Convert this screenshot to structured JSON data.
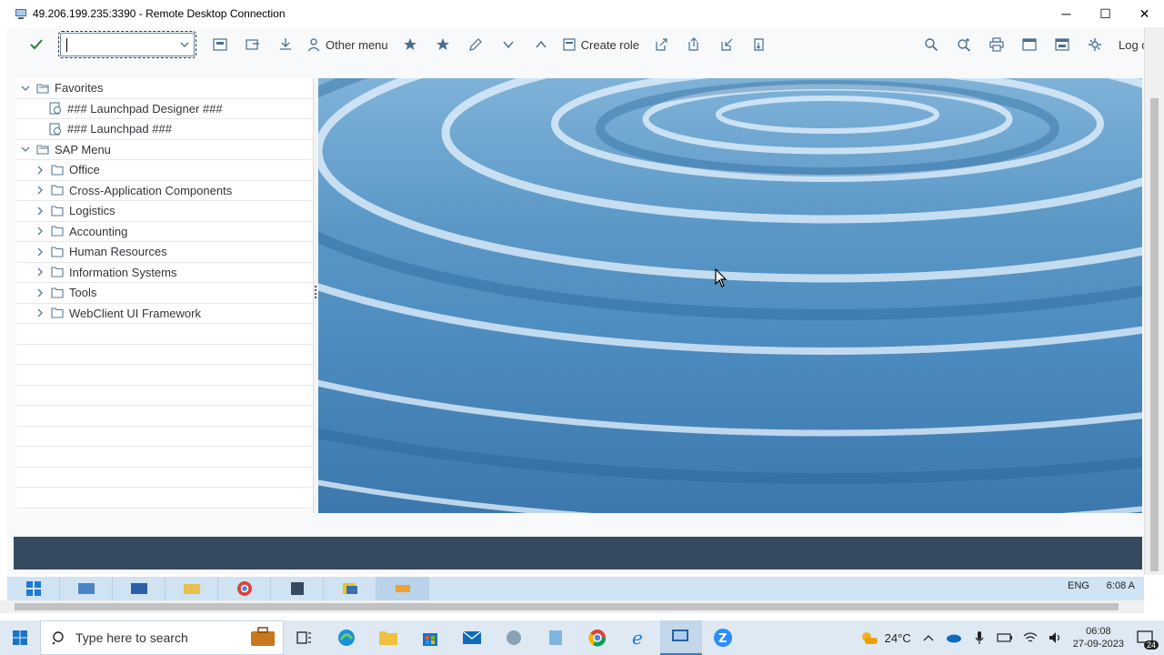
{
  "rdp": {
    "title": "49.206.199.235:3390 - Remote Desktop Connection",
    "controls": {
      "minimize": "─",
      "maximize": "☐",
      "close": "✕"
    }
  },
  "toolbar": {
    "transaction_value": "",
    "other_menu_label": "Other menu",
    "create_role_label": "Create role",
    "logoff_label": "Log off"
  },
  "tree": {
    "favorites": {
      "label": "Favorites",
      "items": [
        {
          "label": "### Launchpad Designer ###"
        },
        {
          "label": "### Launchpad ###"
        }
      ]
    },
    "sap_menu": {
      "label": "SAP Menu",
      "items": [
        {
          "label": "Office"
        },
        {
          "label": "Cross-Application Components"
        },
        {
          "label": "Logistics"
        },
        {
          "label": "Accounting"
        },
        {
          "label": "Human Resources"
        },
        {
          "label": "Information Systems"
        },
        {
          "label": "Tools"
        },
        {
          "label": "WebClient UI Framework"
        }
      ]
    }
  },
  "remote_taskbar": {
    "lang": "ENG",
    "time": "6:08 A"
  },
  "taskbar": {
    "search_placeholder": "Type here to search",
    "weather": "24°C",
    "time": "06:08",
    "date": "27-09-2023",
    "notification_count": "24"
  },
  "colors": {
    "sap_shell": "#354a5f",
    "sap_bg": "#f7f9fa",
    "accent_check": "#2b7d2b",
    "taskbar": "#dfe9f3"
  }
}
